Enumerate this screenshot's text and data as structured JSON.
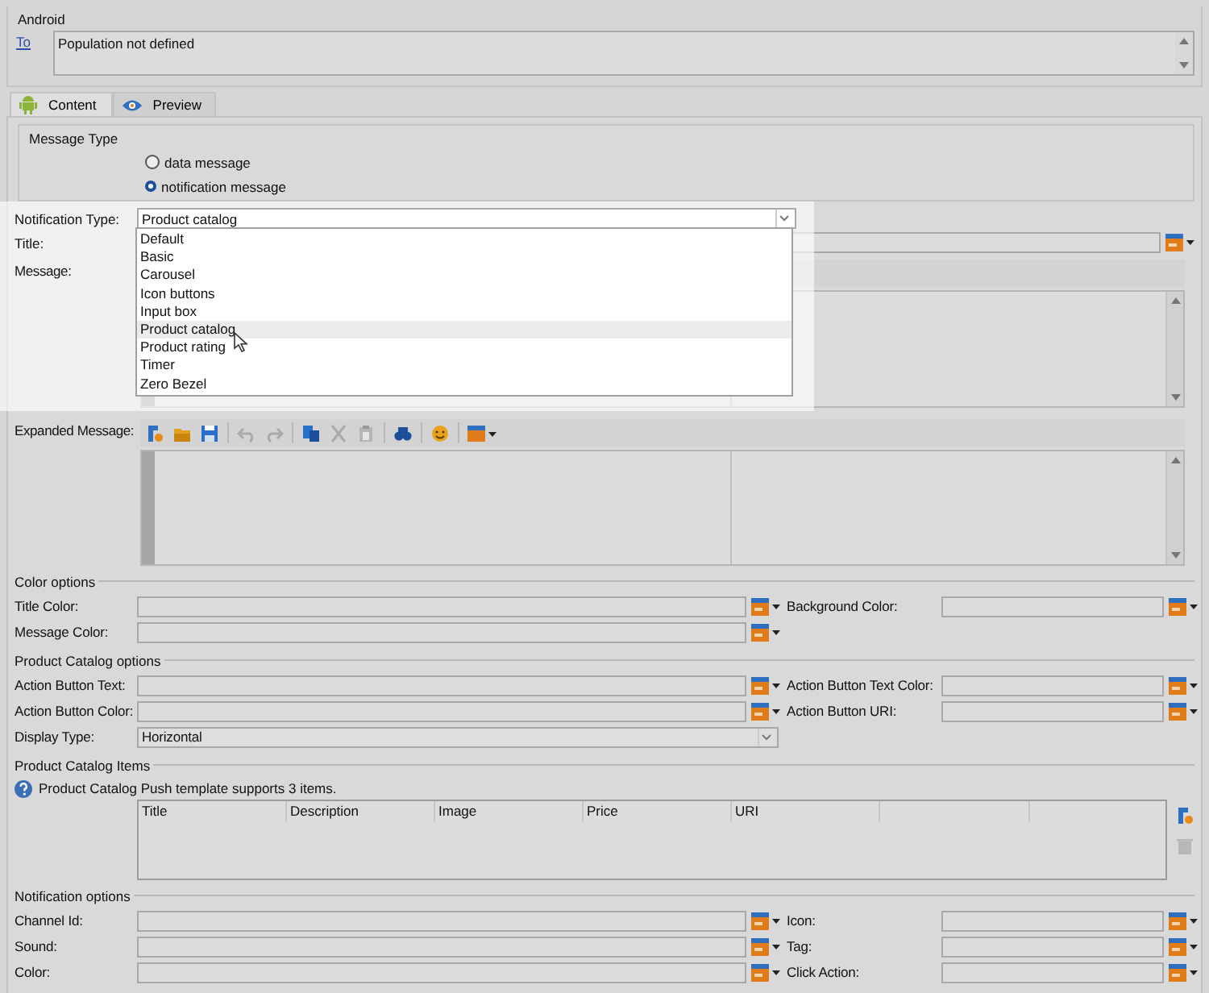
{
  "recipient": {
    "section": "Android",
    "link": "To",
    "value": "Population not defined"
  },
  "tabs": [
    {
      "label": "Content",
      "kind": "android",
      "selected": true
    },
    {
      "label": "Preview",
      "kind": "eye",
      "selected": false
    }
  ],
  "message_type": {
    "title": "Message Type",
    "options": [
      {
        "label": "data message",
        "selected": false
      },
      {
        "label": "notification message",
        "selected": true
      }
    ]
  },
  "notification_type": {
    "label": "Notification Type:",
    "value": "Product catalog",
    "expanded": true,
    "options": [
      {
        "label": "Default",
        "selected": false
      },
      {
        "label": "Basic",
        "selected": false
      },
      {
        "label": "Carousel",
        "selected": false
      },
      {
        "label": "Icon buttons",
        "selected": false
      },
      {
        "label": "Input box",
        "selected": false
      },
      {
        "label": "Product catalog",
        "selected": true
      },
      {
        "label": "Product rating",
        "selected": false
      },
      {
        "label": "Timer",
        "selected": false
      },
      {
        "label": "Zero Bezel",
        "selected": false
      }
    ]
  },
  "title_field": {
    "label": "Title:"
  },
  "message_field": {
    "label": "Message:"
  },
  "expanded_message": {
    "label": "Expanded Message:",
    "toolbar": [
      [
        {
          "kind": "add",
          "disabled": false
        },
        {
          "kind": "open",
          "disabled": false
        },
        {
          "kind": "save",
          "disabled": false
        }
      ],
      [
        {
          "kind": "undo",
          "disabled": true
        },
        {
          "kind": "redo",
          "disabled": true
        }
      ],
      [
        {
          "kind": "copy",
          "disabled": false
        },
        {
          "kind": "cut",
          "disabled": true
        },
        {
          "kind": "paste",
          "disabled": true
        }
      ],
      [
        {
          "kind": "find",
          "disabled": false
        }
      ],
      [
        {
          "kind": "emoji",
          "disabled": false
        }
      ],
      [
        {
          "kind": "insert",
          "disabled": false
        }
      ]
    ]
  },
  "sections": [
    {
      "title": "Color options",
      "kind": "form",
      "rows": [
        [
          {
            "kind": "text",
            "label": "Title Color:"
          },
          {
            "kind": "text",
            "label": "Background Color:"
          }
        ],
        [
          {
            "kind": "text",
            "label": "Message Color:"
          }
        ]
      ]
    },
    {
      "title": "Product Catalog options",
      "kind": "form",
      "rows": [
        [
          {
            "kind": "text",
            "label": "Action Button Text:"
          },
          {
            "kind": "text",
            "label": "Action Button Text Color:"
          }
        ],
        [
          {
            "kind": "text",
            "label": "Action Button Color:"
          },
          {
            "kind": "text",
            "label": "Action Button URI:"
          }
        ],
        [
          {
            "kind": "select",
            "label": "Display Type:",
            "value": "Horizontal"
          }
        ]
      ]
    },
    {
      "title": "Product Catalog Items",
      "kind": "table",
      "info": "Product Catalog Push template supports 3 items.",
      "columns": [
        "Title",
        "Description",
        "Image",
        "Price",
        "URI"
      ],
      "actions": [
        {
          "kind": "add",
          "disabled": false
        },
        {
          "kind": "delete",
          "disabled": true
        }
      ]
    },
    {
      "title": "Notification options",
      "kind": "form",
      "rows": [
        [
          {
            "kind": "text",
            "label": "Channel Id:"
          },
          {
            "kind": "text",
            "label": "Icon:"
          }
        ],
        [
          {
            "kind": "text",
            "label": "Sound:"
          },
          {
            "kind": "text",
            "label": "Tag:"
          }
        ],
        [
          {
            "kind": "text",
            "label": "Color:"
          },
          {
            "kind": "text",
            "label": "Click Action:"
          }
        ]
      ]
    }
  ]
}
